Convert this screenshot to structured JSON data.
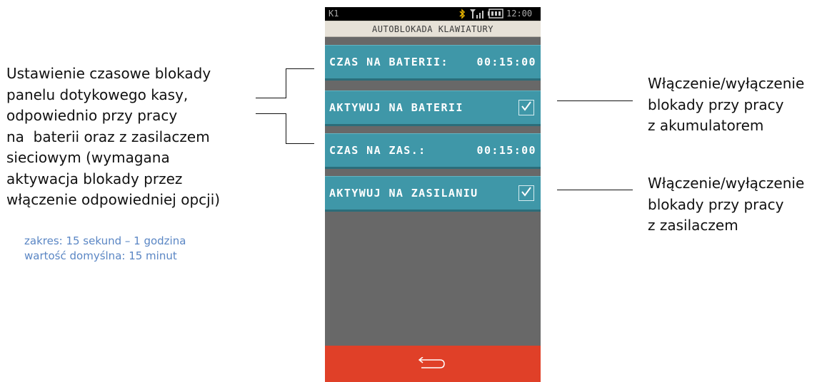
{
  "left_annotation": {
    "lines": [
      "Ustawienie czasowe blokady",
      "panelu dotykowego kasy,",
      "odpowiednio przy pracy",
      "na  baterii oraz z zasilaczem",
      "sieciowym (wymagana",
      "aktywacja blokady przez",
      "włączenie odpowiedniej opcji)"
    ],
    "range": "zakres: 15 sekund – 1 godzina",
    "default": "wartość domyślna: 15 minut"
  },
  "right_annotation_1": {
    "lines": [
      "Włączenie/wyłączenie",
      "blokady przy pracy",
      "z akumulatorem"
    ]
  },
  "right_annotation_2": {
    "lines": [
      "Włączenie/wyłączenie",
      "blokady przy pracy",
      "z zasilaczem"
    ]
  },
  "device": {
    "status": {
      "operator": "K1",
      "time": "12:00",
      "icons": [
        "bluetooth-icon",
        "signal-icon",
        "battery-icon"
      ]
    },
    "title": "AUTOBLOKADA KLAWIATURY",
    "rows": [
      {
        "label": "CZAS NA BATERII:",
        "value": "00:15:00"
      },
      {
        "label": "AKTYWUJ NA BATERII",
        "checked": true
      },
      {
        "label": "CZAS NA ZAS.:",
        "value": "00:15:00"
      },
      {
        "label": "AKTYWUJ NA ZASILANIU",
        "checked": true
      }
    ],
    "back_icon": "back-arrow-icon"
  },
  "colors": {
    "row_bg": "#3f97a8",
    "screen_bg": "#686868",
    "title_bg": "#e6e1d7",
    "bottom_bar": "#e04028",
    "annotation_blue": "#5a86c4",
    "bluetooth": "#e8b400"
  }
}
